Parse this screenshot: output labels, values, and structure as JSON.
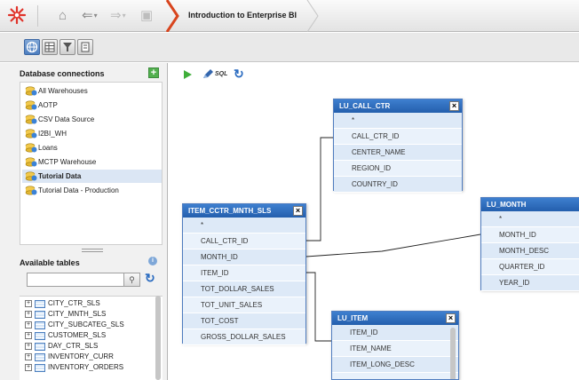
{
  "breadcrumb": {
    "title": "Introduction to Enterprise BI"
  },
  "icons": {
    "logo": "logo-starburst-icon",
    "home": "home-icon",
    "back": "back-arrow-icon",
    "forward": "forward-arrow-icon",
    "up": "up-folder-icon",
    "dropdown": "chevron-down-icon"
  },
  "connections": {
    "header": "Database connections",
    "items": [
      {
        "label": "All Warehouses",
        "bold": false,
        "selected": false
      },
      {
        "label": "AOTP",
        "bold": false,
        "selected": false
      },
      {
        "label": "CSV Data Source",
        "bold": false,
        "selected": false
      },
      {
        "label": "I2BI_WH",
        "bold": false,
        "selected": false
      },
      {
        "label": "Loans",
        "bold": false,
        "selected": false
      },
      {
        "label": "MCTP Warehouse",
        "bold": false,
        "selected": false
      },
      {
        "label": "Tutorial Data",
        "bold": true,
        "selected": true
      },
      {
        "label": "Tutorial Data - Production",
        "bold": false,
        "selected": false
      }
    ]
  },
  "tables_panel": {
    "header": "Available tables",
    "search_value": "",
    "items": [
      "CITY_CTR_SLS",
      "CITY_MNTH_SLS",
      "CITY_SUBCATEG_SLS",
      "CUSTOMER_SLS",
      "DAY_CTR_SLS",
      "INVENTORY_CURR",
      "INVENTORY_ORDERS"
    ]
  },
  "canvas_tools": {
    "sql_label": "SQL"
  },
  "dialogs": {
    "lu_call_ctr": {
      "title": "LU_CALL_CTR",
      "columns": [
        "*",
        "CALL_CTR_ID",
        "CENTER_NAME",
        "REGION_ID",
        "COUNTRY_ID"
      ]
    },
    "item_cctr": {
      "title": "ITEM_CCTR_MNTH_SLS",
      "columns": [
        "*",
        "CALL_CTR_ID",
        "MONTH_ID",
        "ITEM_ID",
        "TOT_DOLLAR_SALES",
        "TOT_UNIT_SALES",
        "TOT_COST",
        "GROSS_DOLLAR_SALES"
      ]
    },
    "lu_month": {
      "title": "LU_MONTH",
      "columns": [
        "*",
        "MONTH_ID",
        "MONTH_DESC",
        "QUARTER_ID",
        "YEAR_ID"
      ]
    },
    "lu_item": {
      "title": "LU_ITEM",
      "columns": [
        "ITEM_ID",
        "ITEM_NAME",
        "ITEM_LONG_DESC"
      ]
    }
  },
  "colors": {
    "accent": "#2a66b5",
    "title_bar": "#2f6fc0",
    "row_alt": "#dde9f7"
  }
}
